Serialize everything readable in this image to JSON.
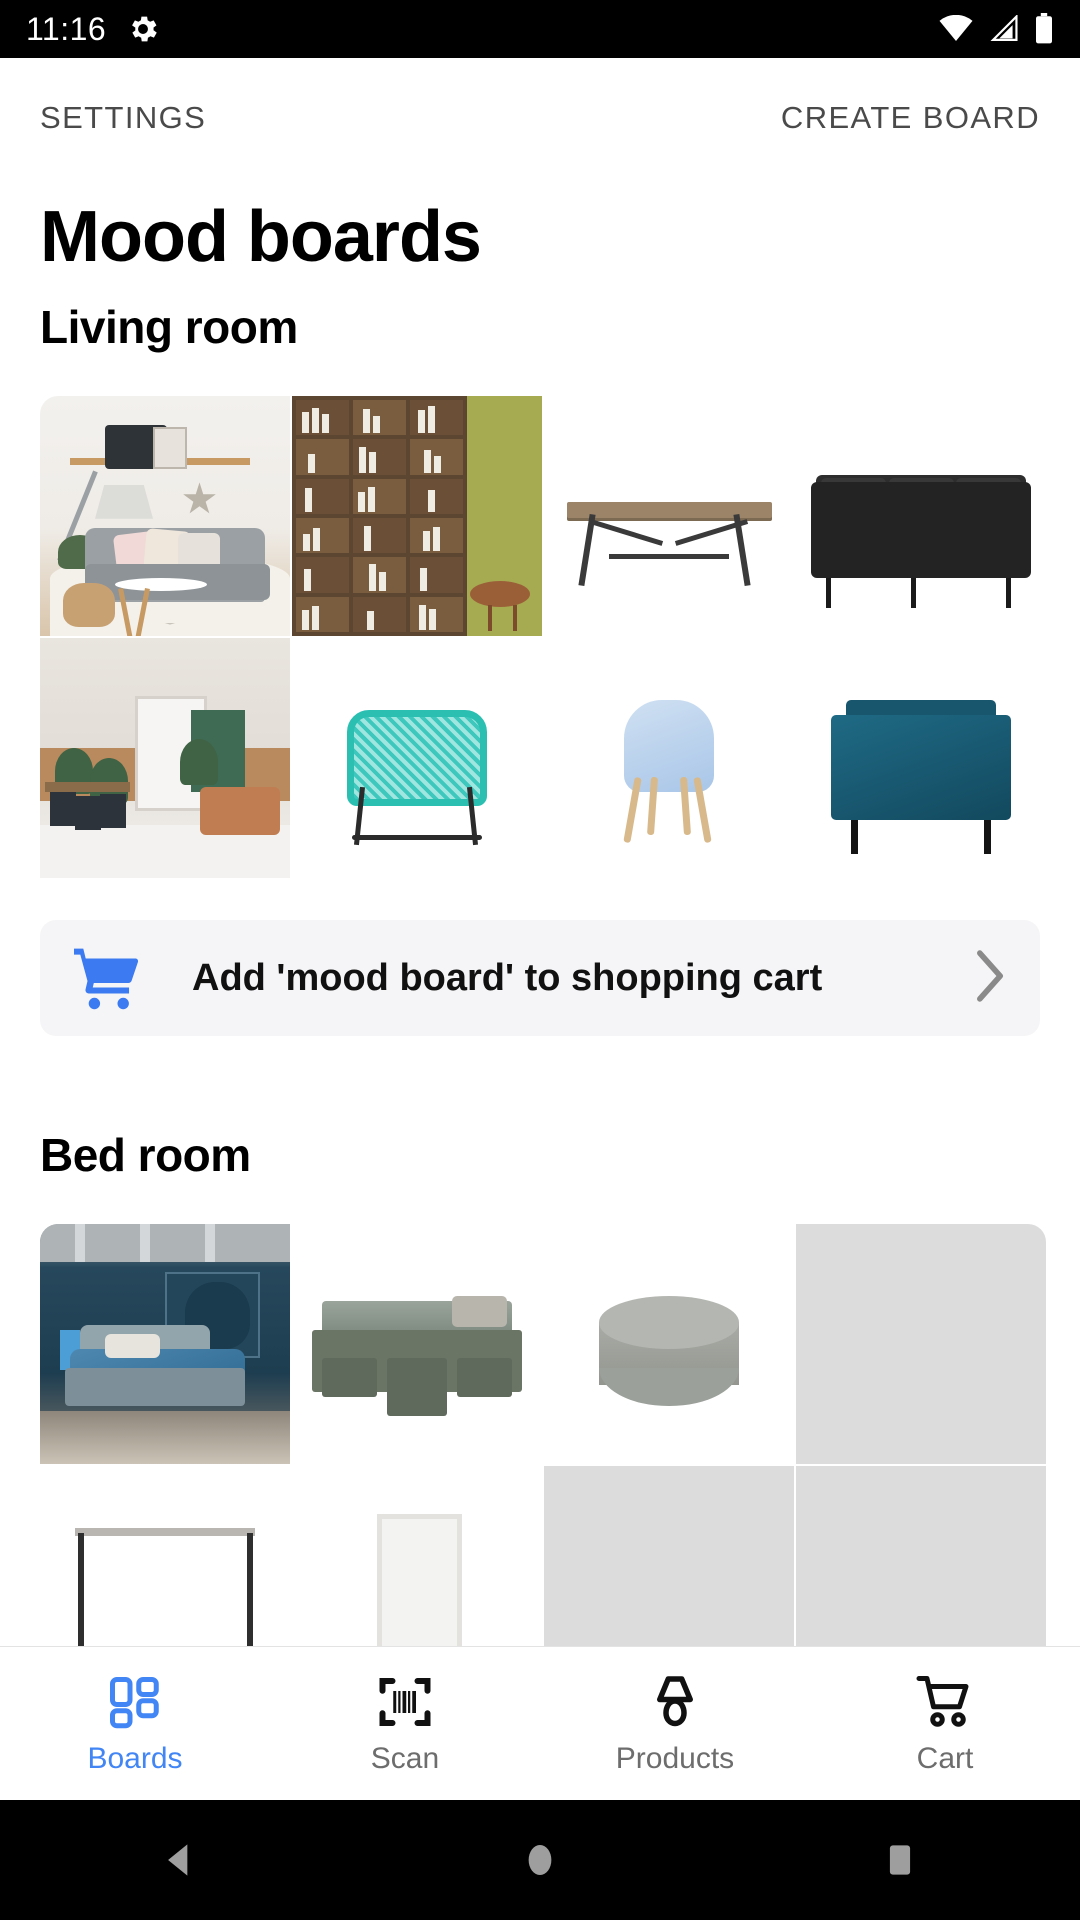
{
  "statusbar": {
    "time": "11:16",
    "icons": [
      "gear-icon",
      "wifi-icon",
      "cellular-signal-icon",
      "battery-icon"
    ]
  },
  "appbar": {
    "settings_label": "SETTINGS",
    "create_board_label": "CREATE BOARD"
  },
  "page": {
    "title": "Mood boards"
  },
  "colors": {
    "accent_blue": "#3b7af0",
    "nav_active_blue": "#4285f4",
    "nav_inactive_grey": "#6d6d6d",
    "skeleton_grey": "#dcdcdc",
    "cart_row_bg": "#f5f5f7",
    "statusbar_bg": "#000000"
  },
  "sections": [
    {
      "title": "Living room",
      "tiles": [
        {
          "name": "scandinavian-living-room-photo",
          "kind": "photo",
          "scene": "s1"
        },
        {
          "name": "wooden-bookcase-olive-wall-photo",
          "kind": "photo",
          "scene": "s2"
        },
        {
          "name": "wooden-dining-table-product",
          "kind": "product",
          "scene": "s3"
        },
        {
          "name": "black-three-seater-sofa-product",
          "kind": "product",
          "scene": "s4"
        },
        {
          "name": "industrial-loft-dining-room-photo",
          "kind": "photo",
          "scene": "s5"
        },
        {
          "name": "turquoise-rattan-chair-product",
          "kind": "product",
          "scene": "s6"
        },
        {
          "name": "light-blue-shell-chair-product",
          "kind": "product",
          "scene": "s7"
        },
        {
          "name": "teal-velvet-armchair-product",
          "kind": "product",
          "scene": "s8"
        }
      ],
      "cart_row": {
        "label": "Add 'mood board' to shopping cart",
        "icon": "shopping-cart-icon",
        "chevron": "chevron-right-icon"
      }
    },
    {
      "title": "Bed room",
      "tiles": [
        {
          "name": "blue-bedroom-photo",
          "kind": "photo",
          "scene": "s9"
        },
        {
          "name": "olive-bed-with-drawers-product",
          "kind": "product",
          "scene": "s10"
        },
        {
          "name": "grey-round-pouf-product",
          "kind": "product",
          "scene": "s11"
        },
        {
          "name": "loading-placeholder-1",
          "kind": "skeleton",
          "scene": ""
        },
        {
          "name": "side-table-frame-product",
          "kind": "product",
          "scene": "s12"
        },
        {
          "name": "white-shelf-cube-product",
          "kind": "product",
          "scene": "s13"
        },
        {
          "name": "loading-placeholder-2",
          "kind": "skeleton",
          "scene": ""
        },
        {
          "name": "loading-placeholder-3",
          "kind": "skeleton",
          "scene": ""
        }
      ]
    }
  ],
  "bottomnav": {
    "items": [
      {
        "label": "Boards",
        "icon": "boards-grid-icon",
        "active": true
      },
      {
        "label": "Scan",
        "icon": "barcode-scan-icon",
        "active": false
      },
      {
        "label": "Products",
        "icon": "table-lamp-icon",
        "active": false
      },
      {
        "label": "Cart",
        "icon": "shopping-cart-icon",
        "active": false
      }
    ]
  },
  "sysnav": {
    "back": "back-triangle-icon",
    "home": "home-circle-icon",
    "recents": "recents-square-icon"
  }
}
